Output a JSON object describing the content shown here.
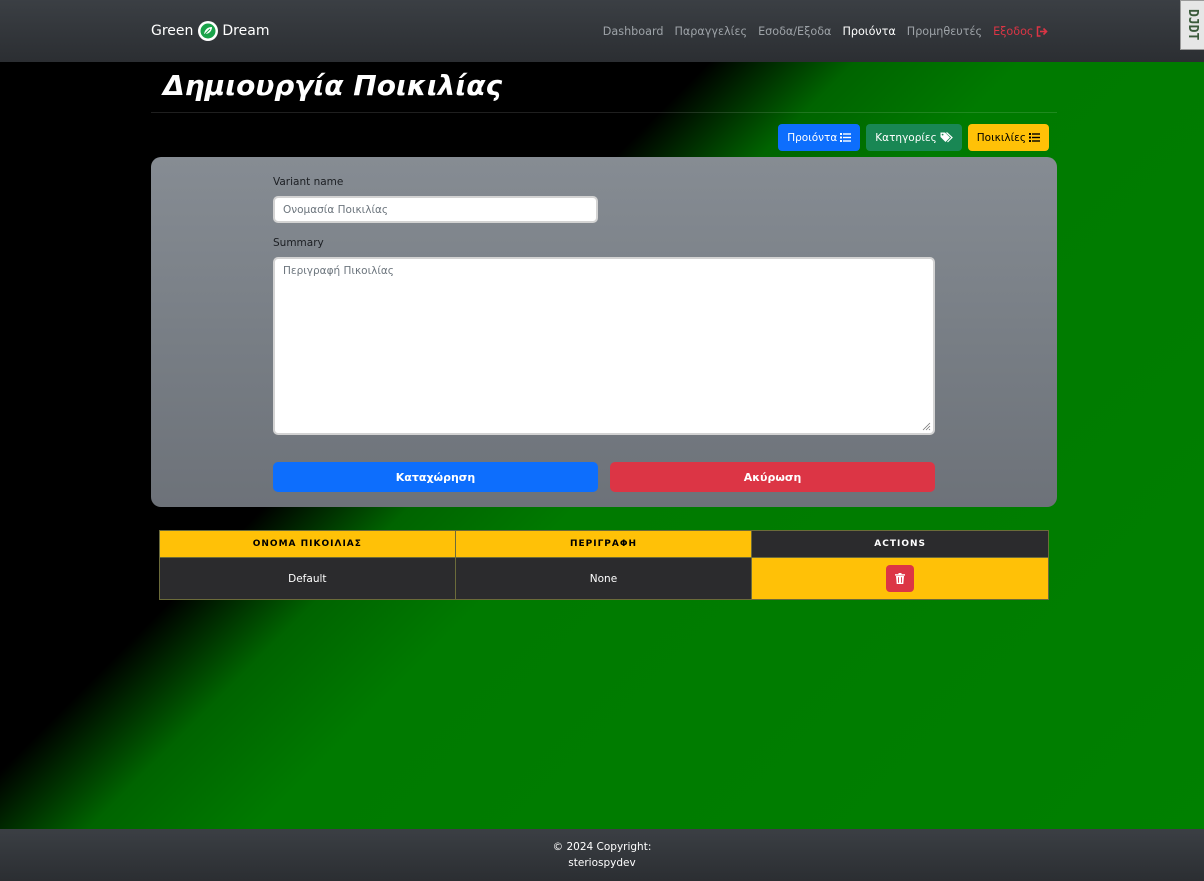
{
  "brand": {
    "left_word": "Green",
    "right_word": "Dream",
    "logo_icon": "leaf-icon"
  },
  "nav": {
    "items": [
      {
        "label": "Dashboard"
      },
      {
        "label": "Παραγγελίες"
      },
      {
        "label": "Εσοδα/Εξοδα"
      },
      {
        "label": "Προιόντα"
      },
      {
        "label": "Προμηθευτές"
      },
      {
        "label": "Εξοδος"
      }
    ],
    "active": "Προιόντα"
  },
  "debug_toolbar": {
    "label": "DJDT"
  },
  "page": {
    "title": "Δημιουργία Ποικιλίας"
  },
  "actions": {
    "products": "Προιόντα",
    "categories": "Κατηγορίες",
    "variants": "Ποικιλίες"
  },
  "form": {
    "name_label": "Variant name",
    "name_placeholder": "Ονομασία Ποικιλίας",
    "summary_label": "Summary",
    "summary_placeholder": "Περιγραφή Πικοιλίας",
    "submit_label": "Καταχώρηση",
    "cancel_label": "Ακύρωση"
  },
  "table": {
    "headers": [
      "ΟΝΟΜΑ ΠΙΚΟΙΛΙΑΣ",
      "ΠΕΡΙΓΡΑΦΗ",
      "ACTIONS"
    ],
    "rows": [
      {
        "name": "Default",
        "description": "None",
        "action_icon": "trash-icon"
      }
    ]
  },
  "footer": {
    "line1": "© 2024 Copyright:",
    "line2": "steriospydev"
  },
  "colors": {
    "primary": "#0d6efd",
    "success": "#198754",
    "warning": "#ffc107",
    "danger": "#dc3545",
    "navbar": "#2b2e32"
  }
}
